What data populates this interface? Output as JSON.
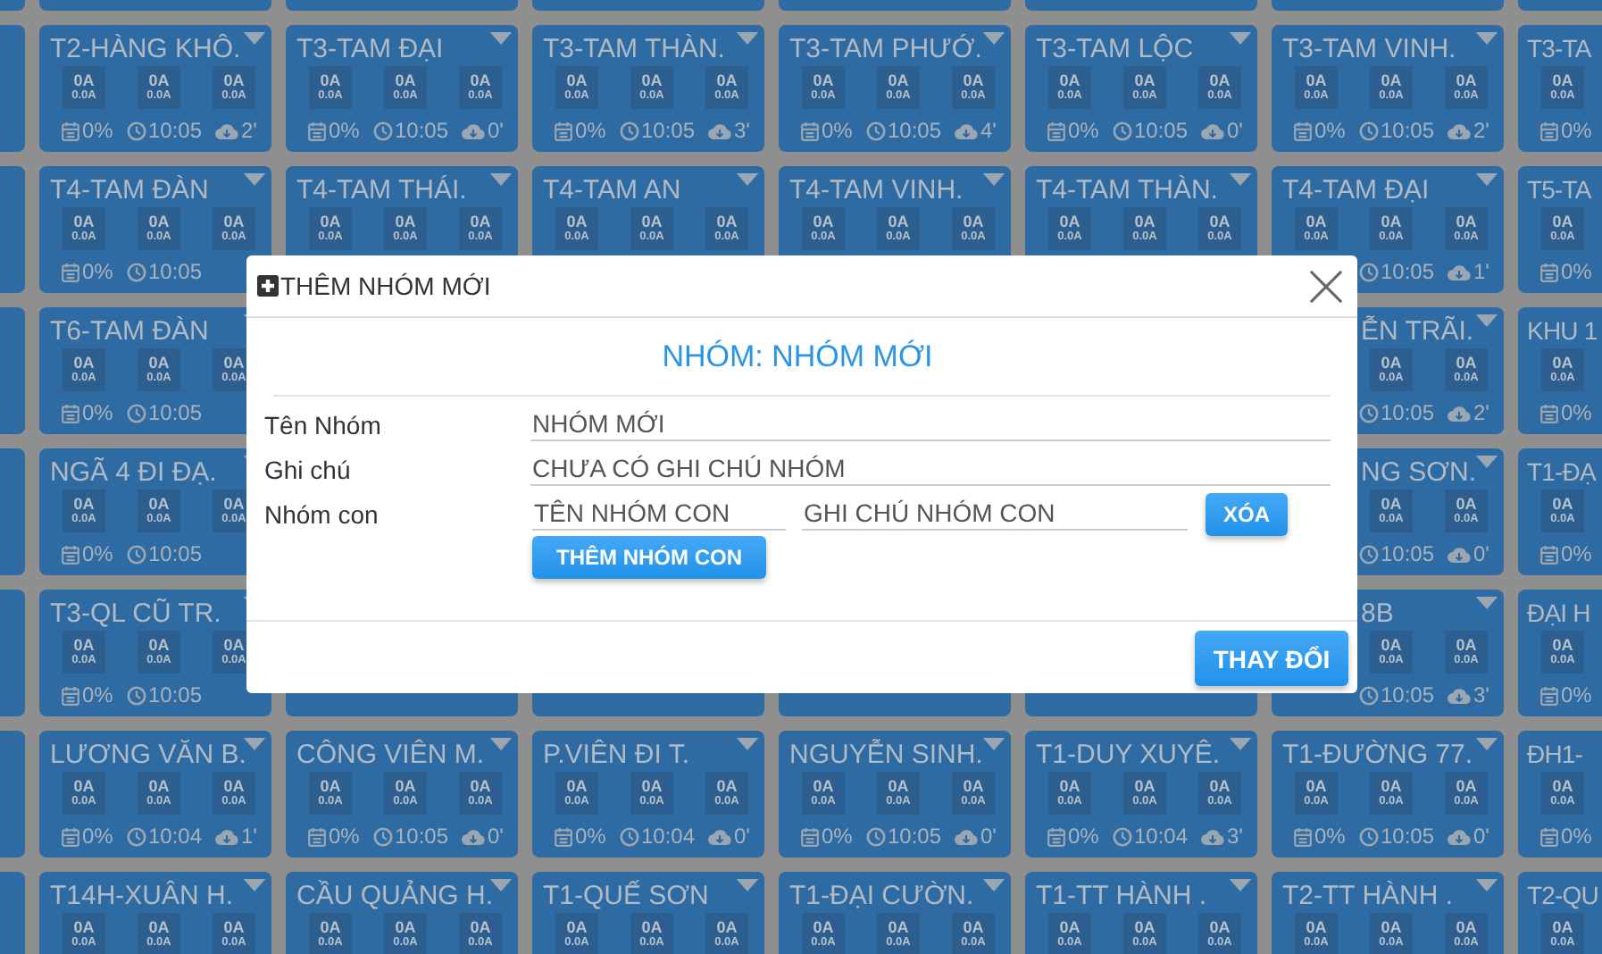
{
  "rows": [
    {
      "tiles": [
        {
          "name": "T2-HÀNG KHÔ.",
          "meters": [
            {
              "main": "0A",
              "sub": "0.0A"
            },
            {
              "main": "0A",
              "sub": "0.0A"
            },
            {
              "main": "0A",
              "sub": "0.0A"
            }
          ],
          "percent": "0%",
          "time": "10:05",
          "age": "2'"
        },
        {
          "name": "T3-TAM ĐẠI",
          "meters": [
            {
              "main": "0A",
              "sub": "0.0A"
            },
            {
              "main": "0A",
              "sub": "0.0A"
            },
            {
              "main": "0A",
              "sub": "0.0A"
            }
          ],
          "percent": "0%",
          "time": "10:05",
          "age": "0'"
        },
        {
          "name": "T3-TAM THÀN.",
          "meters": [
            {
              "main": "0A",
              "sub": "0.0A"
            },
            {
              "main": "0A",
              "sub": "0.0A"
            },
            {
              "main": "0A",
              "sub": "0.0A"
            }
          ],
          "percent": "0%",
          "time": "10:05",
          "age": "3'"
        },
        {
          "name": "T3-TAM PHƯỚ.",
          "meters": [
            {
              "main": "0A",
              "sub": "0.0A"
            },
            {
              "main": "0A",
              "sub": "0.0A"
            },
            {
              "main": "0A",
              "sub": "0.0A"
            }
          ],
          "percent": "0%",
          "time": "10:05",
          "age": "4'"
        },
        {
          "name": "T3-TAM LỘC",
          "meters": [
            {
              "main": "0A",
              "sub": "0.0A"
            },
            {
              "main": "0A",
              "sub": "0.0A"
            },
            {
              "main": "0A",
              "sub": "0.0A"
            }
          ],
          "percent": "0%",
          "time": "10:05",
          "age": "0'"
        },
        {
          "name": "T3-TAM VINH.",
          "meters": [
            {
              "main": "0A",
              "sub": "0.0A"
            },
            {
              "main": "0A",
              "sub": "0.0A"
            },
            {
              "main": "0A",
              "sub": "0.0A"
            }
          ],
          "percent": "0%",
          "time": "10:05",
          "age": "2'"
        },
        {
          "name": "T3-TA",
          "meters": [
            {
              "main": "0A",
              "sub": "0.0A"
            }
          ],
          "percent": "0%"
        }
      ]
    },
    {
      "tiles": [
        {
          "name": "T4-TAM ĐÀN",
          "meters": [
            {
              "main": "0A",
              "sub": "0.0A"
            },
            {
              "main": "0A",
              "sub": "0.0A"
            },
            {
              "main": "0A",
              "sub": "0.0A"
            }
          ],
          "percent": "0%",
          "time": "10:05"
        },
        {
          "name": "T4-TAM THÁI.",
          "meters": [
            {
              "main": "0A",
              "sub": "0.0A"
            },
            {
              "main": "0A",
              "sub": "0.0A"
            },
            {
              "main": "0A",
              "sub": "0.0A"
            }
          ]
        },
        {
          "name": "T4-TAM AN",
          "meters": [
            {
              "main": "0A",
              "sub": "0.0A"
            },
            {
              "main": "0A",
              "sub": "0.0A"
            },
            {
              "main": "0A",
              "sub": "0.0A"
            }
          ]
        },
        {
          "name": "T4-TAM VINH.",
          "meters": [
            {
              "main": "0A",
              "sub": "0.0A"
            },
            {
              "main": "0A",
              "sub": "0.0A"
            },
            {
              "main": "0A",
              "sub": "0.0A"
            }
          ]
        },
        {
          "name": "T4-TAM THÀN.",
          "meters": [
            {
              "main": "0A",
              "sub": "0.0A"
            },
            {
              "main": "0A",
              "sub": "0.0A"
            },
            {
              "main": "0A",
              "sub": "0.0A"
            }
          ]
        },
        {
          "name": "T4-TAM ĐẠI",
          "meters": [
            {
              "main": "0A",
              "sub": "0.0A"
            },
            {
              "main": "0A",
              "sub": "0.0A"
            },
            {
              "main": "0A",
              "sub": "0.0A"
            }
          ],
          "time": "10:05",
          "age": "1'"
        },
        {
          "name": "T5-TA",
          "meters": [
            {
              "main": "0A",
              "sub": "0.0A"
            }
          ],
          "percent": "0%"
        }
      ]
    },
    {
      "tiles": [
        {
          "name": "T6-TAM ĐÀN",
          "meters": [
            {
              "main": "0A",
              "sub": "0.0A"
            },
            {
              "main": "0A",
              "sub": "0.0A"
            },
            {
              "main": "0A",
              "sub": "0.0A"
            }
          ],
          "percent": "0%",
          "time": "10:05"
        }
      ],
      "right_tiles": [
        {
          "name": "ỄN TRÃI.",
          "clipped": true,
          "meters": [
            {
              "main": "0A",
              "sub": "0.0A"
            },
            {
              "main": "0A",
              "sub": "0.0A"
            }
          ],
          "time": "10:05",
          "age": "2'"
        },
        {
          "name": "KHU 1",
          "meters": [
            {
              "main": "0A",
              "sub": "0.0A"
            }
          ],
          "percent": "0%"
        }
      ]
    },
    {
      "tiles": [
        {
          "name": "NGÃ 4 ĐI ĐẠ.",
          "meters": [
            {
              "main": "0A",
              "sub": "0.0A"
            },
            {
              "main": "0A",
              "sub": "0.0A"
            },
            {
              "main": "0A",
              "sub": "0.0A"
            }
          ],
          "percent": "0%",
          "time": "10:05"
        }
      ],
      "right_tiles": [
        {
          "name": "NG SƠN.",
          "clipped": true,
          "meters": [
            {
              "main": "0A",
              "sub": "0.0A"
            },
            {
              "main": "0A",
              "sub": "0.0A"
            }
          ],
          "time": "10:05",
          "age": "0'"
        },
        {
          "name": "T1-ĐẠ",
          "meters": [
            {
              "main": "0A",
              "sub": "0.0A"
            }
          ],
          "percent": "0%"
        }
      ]
    },
    {
      "tiles": [
        {
          "name": "T3-QL CŨ TR.",
          "meters": [
            {
              "main": "0A",
              "sub": "0.0A"
            },
            {
              "main": "0A",
              "sub": "0.0A"
            },
            {
              "main": "0A",
              "sub": "0.0A"
            }
          ],
          "percent": "0%",
          "time": "10:05"
        }
      ],
      "right_tiles": [
        {
          "name": "8B",
          "clipped": true,
          "meters": [
            {
              "main": "0A",
              "sub": "0.0A"
            },
            {
              "main": "0A",
              "sub": "0.0A"
            }
          ],
          "time": "10:05",
          "age": "3'"
        },
        {
          "name": "ĐẠI H",
          "meters": [
            {
              "main": "0A",
              "sub": "0.0A"
            }
          ],
          "percent": "0%"
        }
      ]
    },
    {
      "tiles": [
        {
          "name": "LƯƠNG VĂN B.",
          "meters": [
            {
              "main": "0A",
              "sub": "0.0A"
            },
            {
              "main": "0A",
              "sub": "0.0A"
            },
            {
              "main": "0A",
              "sub": "0.0A"
            }
          ],
          "percent": "0%",
          "time": "10:04",
          "age": "1'"
        },
        {
          "name": "CÔNG VIÊN M.",
          "meters": [
            {
              "main": "0A",
              "sub": "0.0A"
            },
            {
              "main": "0A",
              "sub": "0.0A"
            },
            {
              "main": "0A",
              "sub": "0.0A"
            }
          ],
          "percent": "0%",
          "time": "10:05",
          "age": "0'"
        },
        {
          "name": "P.VIÊN ĐI T.",
          "meters": [
            {
              "main": "0A",
              "sub": "0.0A"
            },
            {
              "main": "0A",
              "sub": "0.0A"
            },
            {
              "main": "0A",
              "sub": "0.0A"
            }
          ],
          "percent": "0%",
          "time": "10:04",
          "age": "0'"
        },
        {
          "name": "NGUYỄN SINH.",
          "meters": [
            {
              "main": "0A",
              "sub": "0.0A"
            },
            {
              "main": "0A",
              "sub": "0.0A"
            },
            {
              "main": "0A",
              "sub": "0.0A"
            }
          ],
          "percent": "0%",
          "time": "10:05",
          "age": "0'"
        },
        {
          "name": "T1-DUY XUYÊ.",
          "meters": [
            {
              "main": "0A",
              "sub": "0.0A"
            },
            {
              "main": "0A",
              "sub": "0.0A"
            },
            {
              "main": "0A",
              "sub": "0.0A"
            }
          ],
          "percent": "0%",
          "time": "10:04",
          "age": "3'"
        },
        {
          "name": "T1-ĐƯỜNG 77.",
          "meters": [
            {
              "main": "0A",
              "sub": "0.0A"
            },
            {
              "main": "0A",
              "sub": "0.0A"
            },
            {
              "main": "0A",
              "sub": "0.0A"
            }
          ],
          "percent": "0%",
          "time": "10:05",
          "age": "0'"
        },
        {
          "name": "ĐH1-",
          "meters": [
            {
              "main": "0A",
              "sub": "0.0A"
            }
          ],
          "percent": "0%"
        }
      ]
    },
    {
      "tiles": [
        {
          "name": "T14H-XUÂN H.",
          "meters": [
            {
              "main": "0A",
              "sub": "0.0A"
            },
            {
              "main": "0A",
              "sub": "0.0A"
            },
            {
              "main": "0A",
              "sub": "0.0A"
            }
          ]
        },
        {
          "name": "CẦU QUẢNG H.",
          "meters": [
            {
              "main": "0A",
              "sub": "0.0A"
            },
            {
              "main": "0A",
              "sub": "0.0A"
            },
            {
              "main": "0A",
              "sub": "0.0A"
            }
          ]
        },
        {
          "name": "T1-QUẾ SƠN",
          "meters": [
            {
              "main": "0A",
              "sub": "0.0A"
            },
            {
              "main": "0A",
              "sub": "0.0A"
            },
            {
              "main": "0A",
              "sub": "0.0A"
            }
          ]
        },
        {
          "name": "T1-ĐẠI CƯỜN.",
          "meters": [
            {
              "main": "0A",
              "sub": "0.0A"
            },
            {
              "main": "0A",
              "sub": "0.0A"
            },
            {
              "main": "0A",
              "sub": "0.0A"
            }
          ]
        },
        {
          "name": "T1-TT HÀNH .",
          "meters": [
            {
              "main": "0A",
              "sub": "0.0A"
            },
            {
              "main": "0A",
              "sub": "0.0A"
            },
            {
              "main": "0A",
              "sub": "0.0A"
            }
          ]
        },
        {
          "name": "T2-TT HÀNH .",
          "meters": [
            {
              "main": "0A",
              "sub": "0.0A"
            },
            {
              "main": "0A",
              "sub": "0.0A"
            },
            {
              "main": "0A",
              "sub": "0.0A"
            }
          ]
        },
        {
          "name": "T2-QU",
          "meters": [
            {
              "main": "0A",
              "sub": "0.0A"
            }
          ]
        }
      ]
    }
  ],
  "dialog": {
    "title": "THÊM NHÓM MỚI",
    "heading": "NHÓM: NHÓM MỚI",
    "fields": [
      {
        "label": "Tên Nhóm",
        "value": "NHÓM MỚI"
      },
      {
        "label": "Ghi chú",
        "value": "CHƯA CÓ GHI CHÚ NHÓM"
      }
    ],
    "subgroup": {
      "label": "Nhóm con",
      "name_value": "TÊN NHÓM CON",
      "note_value": "GHI CHÚ NHÓM CON",
      "delete_button": "XÓA",
      "add_button": "THÊM NHÓM CON"
    },
    "save_button": "THAY ĐỔI"
  }
}
